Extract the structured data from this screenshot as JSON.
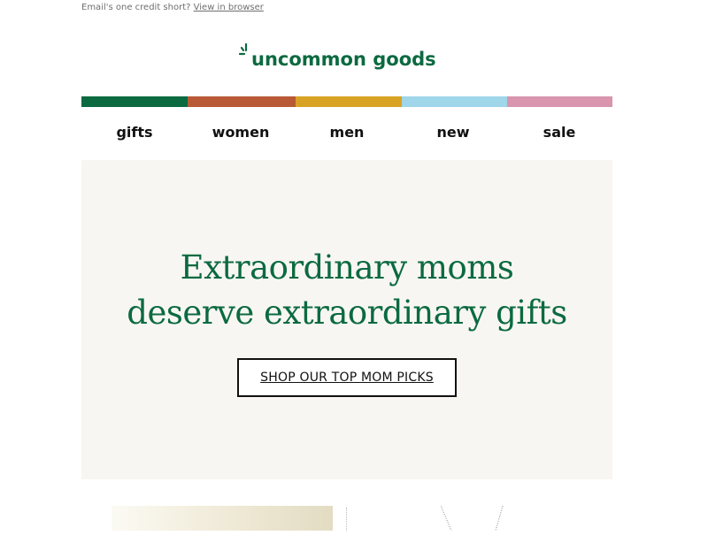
{
  "preheader": {
    "text": "Email's one credit short?",
    "link": "View in browser"
  },
  "brand": {
    "name": "uncommon goods",
    "color": "#0b6a40"
  },
  "stripe_colors": [
    "#0b6a40",
    "#b85a35",
    "#d8a325",
    "#9fd6ea",
    "#d895ad"
  ],
  "nav": {
    "items": [
      {
        "label": "gifts"
      },
      {
        "label": "women"
      },
      {
        "label": "men"
      },
      {
        "label": "new"
      },
      {
        "label": "sale"
      }
    ]
  },
  "hero": {
    "headline_line1": "Extraordinary moms",
    "headline_line2": "deserve extraordinary gifts",
    "cta_label": "SHOP OUR TOP MOM PICKS",
    "background": "#f8f6f2"
  },
  "icons": {
    "logo_mark": "sparkle-icon"
  }
}
